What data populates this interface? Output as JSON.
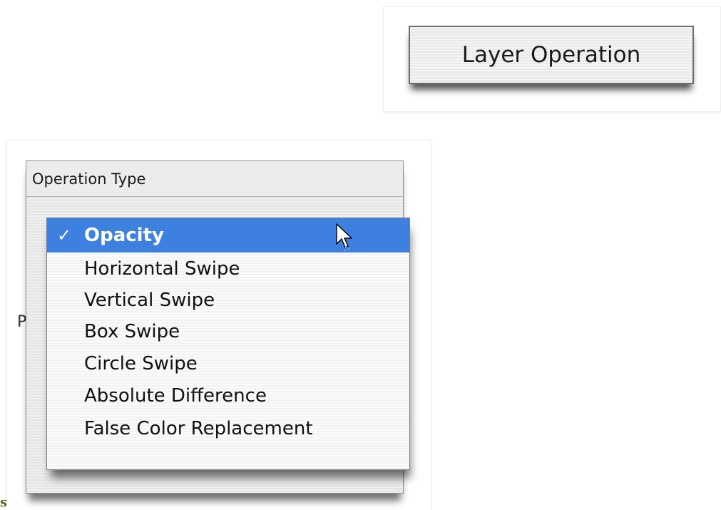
{
  "button_card": {
    "layer_operation_label": "Layer Operation"
  },
  "operation_panel": {
    "header": "Operation Type",
    "obscured_letter": "P",
    "menu": {
      "selected_check": "✓",
      "items": [
        "Opacity",
        "Horizontal Swipe",
        "Vertical Swipe",
        "Box Swipe",
        "Circle Swipe",
        "Absolute Difference",
        "False Color Replacement"
      ]
    }
  },
  "stray_text": "s",
  "colors": {
    "selection": "#3d80df",
    "selection_text": "#ffffff",
    "stray_text": "#5a6b2a"
  },
  "icons": {
    "pointer": "arrow-cursor-icon",
    "checkmark": "checkmark-icon"
  }
}
